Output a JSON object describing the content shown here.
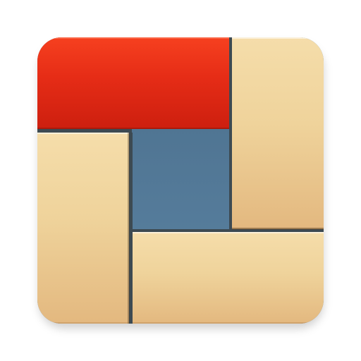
{
  "app_icon": {
    "icon_name": "sliding-block-puzzle-icon",
    "colors": {
      "board": "#5a82a2",
      "wood": "#efd39b",
      "red_block": "#e52c16",
      "gap": "#3d4a52"
    },
    "blocks": [
      {
        "name": "red-block",
        "color": "red"
      },
      {
        "name": "wood-block-right-vertical",
        "color": "wood"
      },
      {
        "name": "wood-block-left-vertical",
        "color": "wood"
      },
      {
        "name": "wood-block-bottom-horizontal",
        "color": "wood"
      }
    ]
  }
}
